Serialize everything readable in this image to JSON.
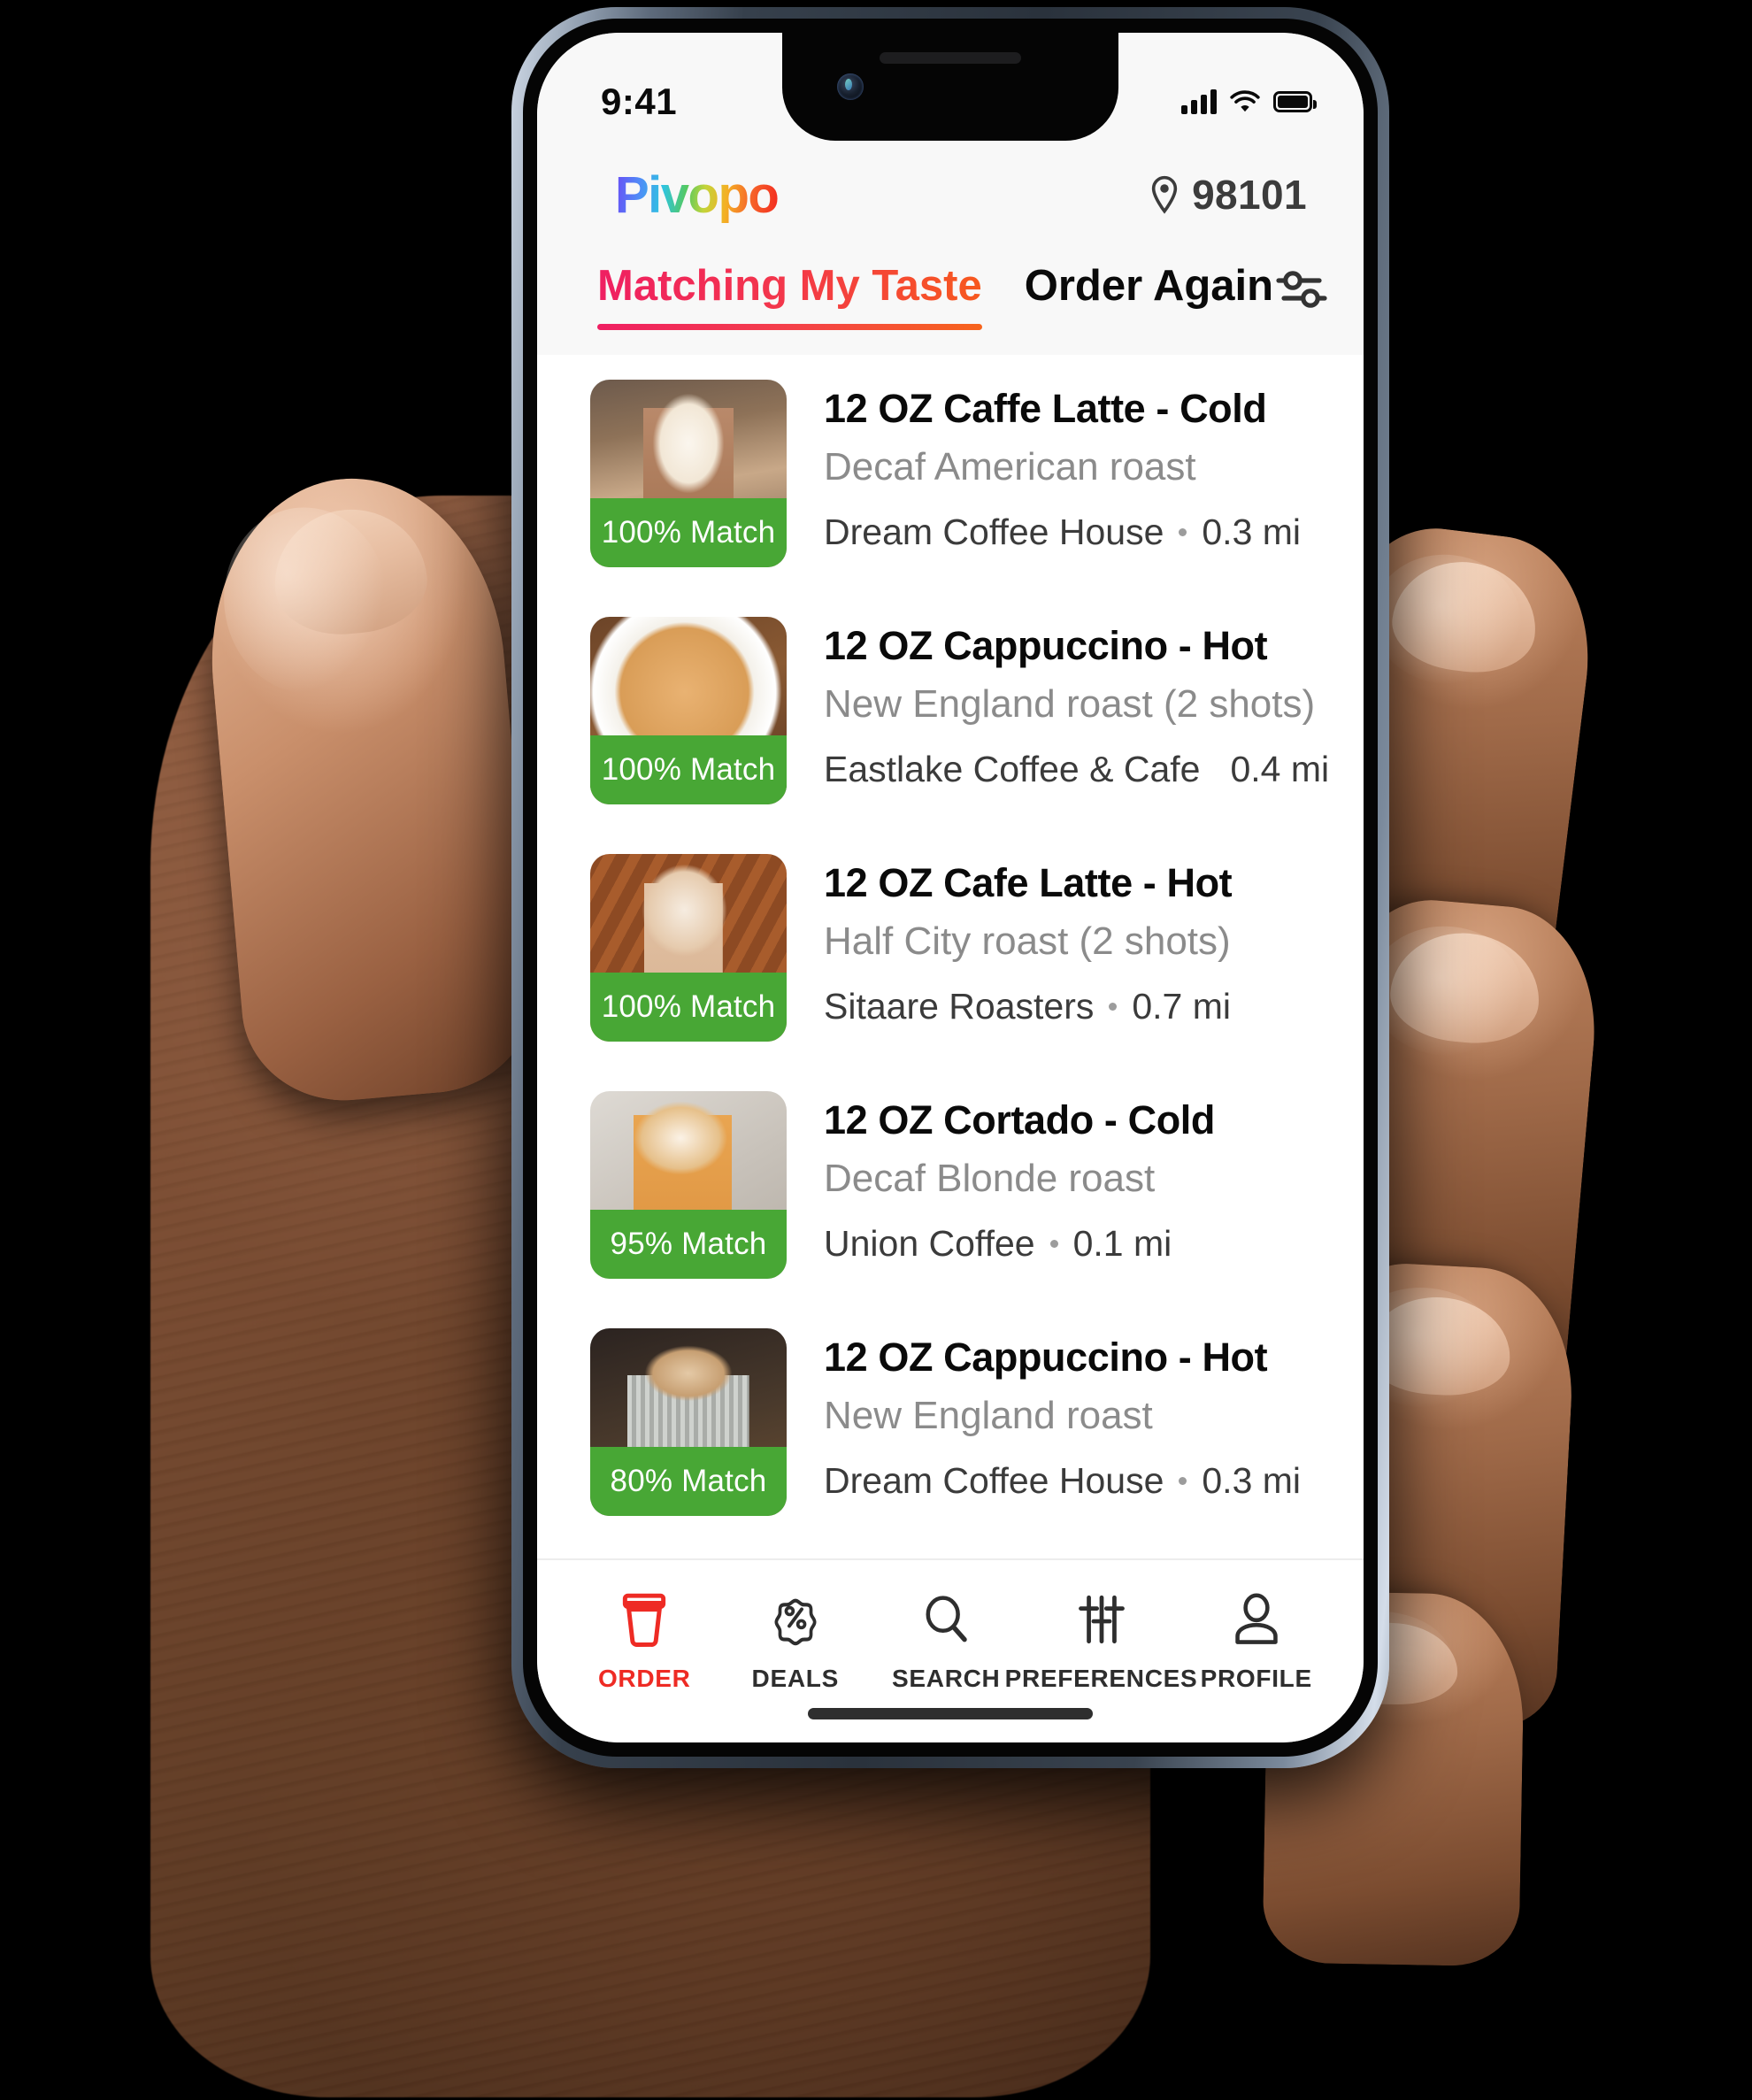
{
  "status_bar": {
    "time": "9:41",
    "signal_icon": "cellular-signal-icon",
    "wifi_icon": "wifi-icon",
    "battery_icon": "battery-icon"
  },
  "header": {
    "logo_text": "Pivopo",
    "location_icon": "map-pin-icon",
    "zip": "98101"
  },
  "tabs": {
    "items": [
      {
        "label": "Matching My Taste",
        "active": true
      },
      {
        "label": "Order Again",
        "active": false
      }
    ],
    "filter_icon": "filter-sliders-icon"
  },
  "list": {
    "items": [
      {
        "title": "12 OZ Caffe Latte - Cold",
        "subtitle": "Decaf American roast",
        "store": "Dream Coffee House",
        "distance": "0.3 mi",
        "match": "100% Match",
        "thumb": "latte-glass-photo"
      },
      {
        "title": "12 OZ Cappuccino - Hot",
        "subtitle": "New England roast (2 shots)",
        "store": "Eastlake Coffee & Cafe",
        "distance": "0.4 mi",
        "match": "100% Match",
        "thumb": "cappuccino-white-mug-photo"
      },
      {
        "title": "12 OZ Cafe Latte - Hot",
        "subtitle": "Half City roast (2 shots)",
        "store": "Sitaare Roasters",
        "distance": "0.7 mi",
        "match": "100% Match",
        "thumb": "latte-art-wood-table-photo"
      },
      {
        "title": "12 OZ Cortado - Cold",
        "subtitle": "Decaf Blonde roast",
        "store": "Union Coffee",
        "distance": "0.1 mi",
        "match": "95% Match",
        "thumb": "cortado-marble-photo"
      },
      {
        "title": "12 OZ Cappuccino - Hot",
        "subtitle": "New England roast",
        "store": "Dream Coffee House",
        "distance": "0.3 mi",
        "match": "80% Match",
        "thumb": "cappuccino-ribbed-mug-photo"
      }
    ]
  },
  "bottom_nav": {
    "items": [
      {
        "label": "ORDER",
        "icon": "coffee-cup-icon",
        "active": true
      },
      {
        "label": "DEALS",
        "icon": "percent-badge-icon",
        "active": false
      },
      {
        "label": "SEARCH",
        "icon": "magnifier-icon",
        "active": false
      },
      {
        "label": "PREFERENCES",
        "icon": "sliders-icon",
        "active": false
      },
      {
        "label": "PROFILE",
        "icon": "person-icon",
        "active": false
      }
    ]
  },
  "colors": {
    "accent_red": "#ee2b24",
    "match_green": "#48a735",
    "tab_gradient_start": "#ef1f62",
    "tab_gradient_end": "#f7591e",
    "muted_text": "#8b8b8b"
  }
}
